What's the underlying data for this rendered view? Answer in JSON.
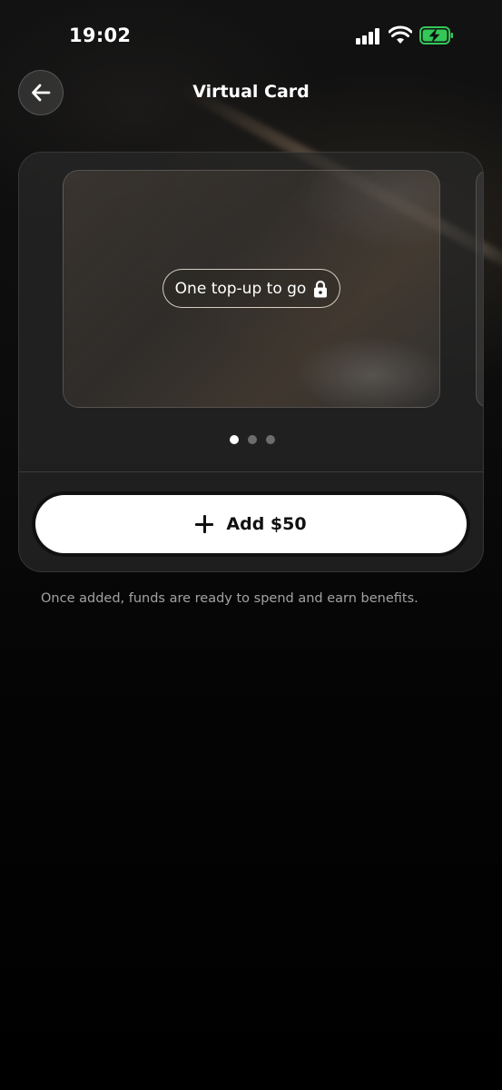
{
  "status_bar": {
    "time": "19:02",
    "icons": [
      "cellular-signal-icon",
      "wifi-icon",
      "battery-charging-icon"
    ],
    "battery_color": "#34c759"
  },
  "header": {
    "title": "Virtual Card",
    "back_icon": "arrow-left-icon"
  },
  "card_carousel": {
    "lock_label": "One top-up to go",
    "lock_icon": "lock-icon",
    "page_count": 3,
    "active_page": 1
  },
  "actions": {
    "add_label": "Add $50",
    "add_icon": "plus-icon"
  },
  "info": {
    "text": "Once added, funds are ready to spend and earn benefits."
  },
  "colors": {
    "background": "#000000",
    "primary_button": "#ffffff",
    "primary_button_text": "#111111"
  }
}
